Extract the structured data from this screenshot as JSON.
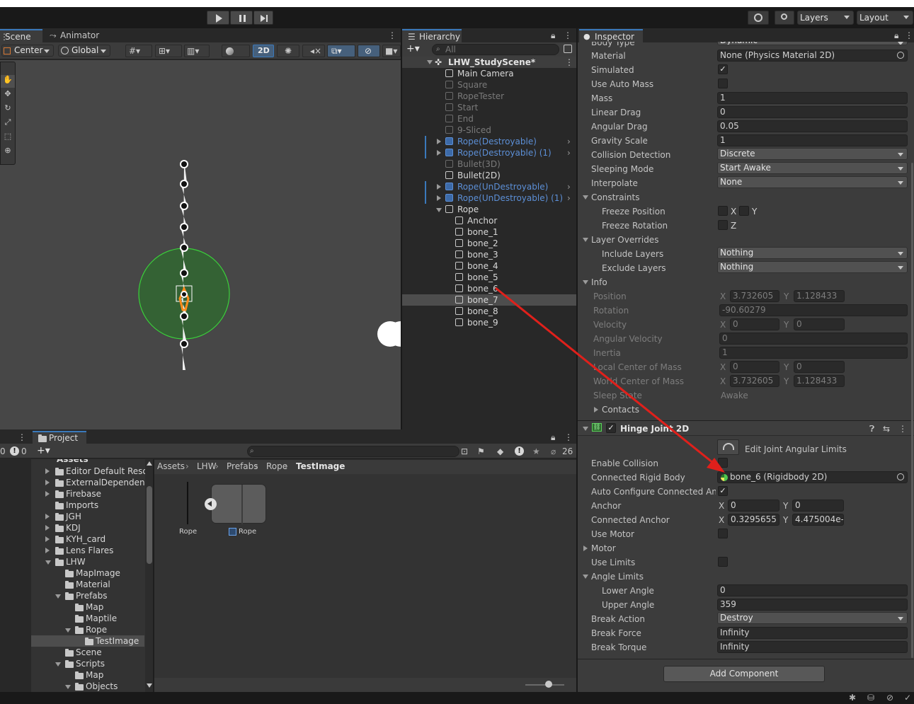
{
  "toolbar": {
    "layers_label": "Layers",
    "layout_label": "Layout"
  },
  "scene_panel": {
    "tab_scene": "Scene",
    "tab_animator": "Animator",
    "pivot_label": "Center",
    "space_label": "Global",
    "mode_2d": "2D"
  },
  "hierarchy": {
    "tab_label": "Hierarchy",
    "search_placeholder": "All",
    "scene_name": "LHW_StudyScene*",
    "items": [
      {
        "label": "Main Camera",
        "state": "normal",
        "indent": 0
      },
      {
        "label": "Square",
        "state": "disabled",
        "indent": 0
      },
      {
        "label": "RopeTester",
        "state": "disabled",
        "indent": 0
      },
      {
        "label": "Start",
        "state": "disabled",
        "indent": 0
      },
      {
        "label": "End",
        "state": "disabled",
        "indent": 0
      },
      {
        "label": "9-Sliced",
        "state": "disabled",
        "indent": 0
      },
      {
        "label": "Rope(Destroyable)",
        "state": "prefab",
        "indent": 0
      },
      {
        "label": "Rope(Destroyable) (1)",
        "state": "prefab",
        "indent": 0
      },
      {
        "label": "Bullet(3D)",
        "state": "disabled",
        "indent": 0
      },
      {
        "label": "Bullet(2D)",
        "state": "normal",
        "indent": 0
      },
      {
        "label": "Rope(UnDestroyable)",
        "state": "prefab",
        "indent": 0
      },
      {
        "label": "Rope(UnDestroyable) (1)",
        "state": "prefab",
        "indent": 0
      },
      {
        "label": "Rope",
        "state": "normal",
        "indent": 0
      },
      {
        "label": "Anchor",
        "state": "normal",
        "indent": 1
      },
      {
        "label": "bone_1",
        "state": "normal",
        "indent": 1
      },
      {
        "label": "bone_2",
        "state": "normal",
        "indent": 1
      },
      {
        "label": "bone_3",
        "state": "normal",
        "indent": 1
      },
      {
        "label": "bone_4",
        "state": "normal",
        "indent": 1
      },
      {
        "label": "bone_5",
        "state": "normal",
        "indent": 1
      },
      {
        "label": "bone_6",
        "state": "normal",
        "indent": 1
      },
      {
        "label": "bone_7",
        "state": "selected",
        "indent": 1
      },
      {
        "label": "bone_8",
        "state": "normal",
        "indent": 1
      },
      {
        "label": "bone_9",
        "state": "normal",
        "indent": 1
      }
    ]
  },
  "inspector": {
    "tab_label": "Inspector",
    "body_type_value": "Dynamic",
    "body_type_label": "Body Type",
    "material_label": "Material",
    "material_value": "None (Physics Material 2D)",
    "simulated_label": "Simulated",
    "use_auto_mass_label": "Use Auto Mass",
    "mass_label": "Mass",
    "mass_value": "1",
    "linear_drag_label": "Linear Drag",
    "linear_drag_value": "0",
    "angular_drag_label": "Angular Drag",
    "angular_drag_value": "0.05",
    "gravity_scale_label": "Gravity Scale",
    "gravity_scale_value": "1",
    "collision_detection_label": "Collision Detection",
    "collision_detection_value": "Discrete",
    "sleeping_mode_label": "Sleeping Mode",
    "sleeping_mode_value": "Start Awake",
    "interpolate_label": "Interpolate",
    "interpolate_value": "None",
    "constraints_label": "Constraints",
    "freeze_position_label": "Freeze Position",
    "freeze_rotation_label": "Freeze Rotation",
    "axis_x": "X",
    "axis_y": "Y",
    "axis_z": "Z",
    "layer_overrides_label": "Layer Overrides",
    "include_layers_label": "Include Layers",
    "include_layers_value": "Nothing",
    "exclude_layers_label": "Exclude Layers",
    "exclude_layers_value": "Nothing",
    "info_label": "Info",
    "position_label": "Position",
    "position_x": "3.732605",
    "position_y": "1.128433",
    "rotation_label": "Rotation",
    "rotation_value": "-90.60279",
    "velocity_label": "Velocity",
    "velocity_x": "0",
    "velocity_y": "0",
    "angular_velocity_label": "Angular Velocity",
    "angular_velocity_value": "0",
    "inertia_label": "Inertia",
    "inertia_value": "1",
    "local_com_label": "Local Center of Mass",
    "local_com_x": "0",
    "local_com_y": "0",
    "world_com_label": "World Center of Mass",
    "world_com_x": "3.732605",
    "world_com_y": "1.128433",
    "sleep_state_label": "Sleep State",
    "sleep_state_value": "Awake",
    "contacts_label": "Contacts",
    "hinge_title": "Hinge Joint 2D",
    "edit_limits_label": "Edit Joint Angular Limits",
    "enable_collision_label": "Enable Collision",
    "connected_rb_label": "Connected Rigid Body",
    "connected_rb_value": "bone_6 (Rigidbody 2D)",
    "auto_configure_label": "Auto Configure Connected Anch",
    "anchor_label": "Anchor",
    "anchor_x": "0",
    "anchor_y": "0",
    "connected_anchor_label": "Connected Anchor",
    "connected_anchor_x": "0.3295655",
    "connected_anchor_y": "4.475004e-",
    "use_motor_label": "Use Motor",
    "motor_label": "Motor",
    "use_limits_label": "Use Limits",
    "angle_limits_label": "Angle Limits",
    "lower_angle_label": "Lower Angle",
    "lower_angle_value": "0",
    "upper_angle_label": "Upper Angle",
    "upper_angle_value": "359",
    "break_action_label": "Break Action",
    "break_action_value": "Destroy",
    "break_force_label": "Break Force",
    "break_force_value": "Infinity",
    "break_torque_label": "Break Torque",
    "break_torque_value": "Infinity",
    "add_component_label": "Add Component"
  },
  "project": {
    "tab_label": "Project",
    "console_count": "0",
    "console_warn_count": "0",
    "hidden_count": "26",
    "tree_root": "Assets",
    "tree": [
      {
        "label": "Editor Default Resou",
        "indent": 1,
        "arrow": "right"
      },
      {
        "label": "ExternalDependenc",
        "indent": 1,
        "arrow": "right"
      },
      {
        "label": "Firebase",
        "indent": 1,
        "arrow": "right"
      },
      {
        "label": "Imports",
        "indent": 1,
        "arrow": "none"
      },
      {
        "label": "JGH",
        "indent": 1,
        "arrow": "right"
      },
      {
        "label": "KDJ",
        "indent": 1,
        "arrow": "right"
      },
      {
        "label": "KYH_card",
        "indent": 1,
        "arrow": "right"
      },
      {
        "label": "Lens Flares",
        "indent": 1,
        "arrow": "right"
      },
      {
        "label": "LHW",
        "indent": 1,
        "arrow": "down"
      },
      {
        "label": "MapImage",
        "indent": 2,
        "arrow": "none"
      },
      {
        "label": "Material",
        "indent": 2,
        "arrow": "none"
      },
      {
        "label": "Prefabs",
        "indent": 2,
        "arrow": "down"
      },
      {
        "label": "Map",
        "indent": 3,
        "arrow": "none"
      },
      {
        "label": "Maptile",
        "indent": 3,
        "arrow": "none"
      },
      {
        "label": "Rope",
        "indent": 3,
        "arrow": "down"
      },
      {
        "label": "TestImage",
        "indent": 4,
        "arrow": "none",
        "selected": true
      },
      {
        "label": "Scene",
        "indent": 2,
        "arrow": "none"
      },
      {
        "label": "Scripts",
        "indent": 2,
        "arrow": "down"
      },
      {
        "label": "Map",
        "indent": 3,
        "arrow": "none"
      },
      {
        "label": "Objects",
        "indent": 3,
        "arrow": "down"
      }
    ],
    "breadcrumb": [
      "Assets",
      "LHW",
      "Prefabs",
      "Rope",
      "TestImage"
    ],
    "assets": [
      {
        "label": "Rope"
      },
      {
        "label": "Rope"
      }
    ]
  },
  "colors": {
    "accent_blue": "#3a79bb",
    "prefab_blue": "#5c8fd6",
    "arrow_red": "#e0201b",
    "green_circle": "#2f7a2f"
  }
}
